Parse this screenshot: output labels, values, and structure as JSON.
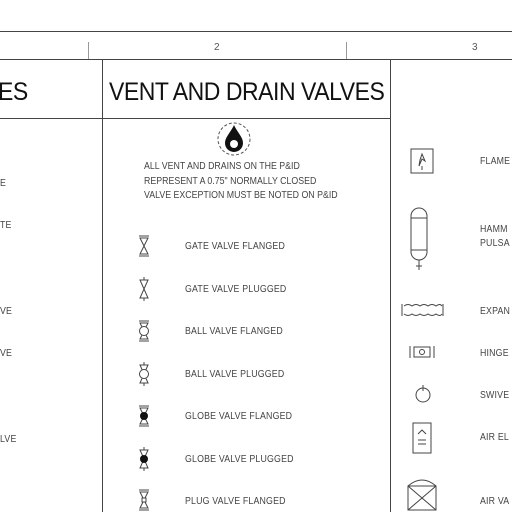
{
  "zones": {
    "zone2": "2",
    "zone3": "3"
  },
  "left_column": {
    "header_fragment": "ES",
    "labels": [
      "E",
      "TE",
      "VE",
      "VE",
      "LVE"
    ]
  },
  "middle_column": {
    "title": "VENT AND DRAIN VALVES",
    "note_lines": [
      "ALL VENT AND DRAINS ON THE P&ID",
      "REPRESENT A 0.75\" NORMALLY CLOSED",
      "VALVE EXCEPTION MUST BE NOTED ON P&ID"
    ],
    "valves": [
      {
        "label": "GATE VALVE FLANGED",
        "icon": "gate-valve-flanged-icon"
      },
      {
        "label": "GATE VALVE PLUGGED",
        "icon": "gate-valve-plugged-icon"
      },
      {
        "label": "BALL VALVE FLANGED",
        "icon": "ball-valve-flanged-icon"
      },
      {
        "label": "BALL VALVE PLUGGED",
        "icon": "ball-valve-plugged-icon"
      },
      {
        "label": "GLOBE VALVE FLANGED",
        "icon": "globe-valve-flanged-icon"
      },
      {
        "label": "GLOBE VALVE PLUGGED",
        "icon": "globe-valve-plugged-icon"
      },
      {
        "label": "PLUG VALVE FLANGED",
        "icon": "plug-valve-flanged-icon"
      }
    ]
  },
  "right_column": {
    "labels": [
      "FLAME",
      "HAMM",
      "PULSA",
      "EXPAN",
      "HINGE",
      "SWIVE",
      "AIR EL",
      "AIR VA"
    ]
  }
}
